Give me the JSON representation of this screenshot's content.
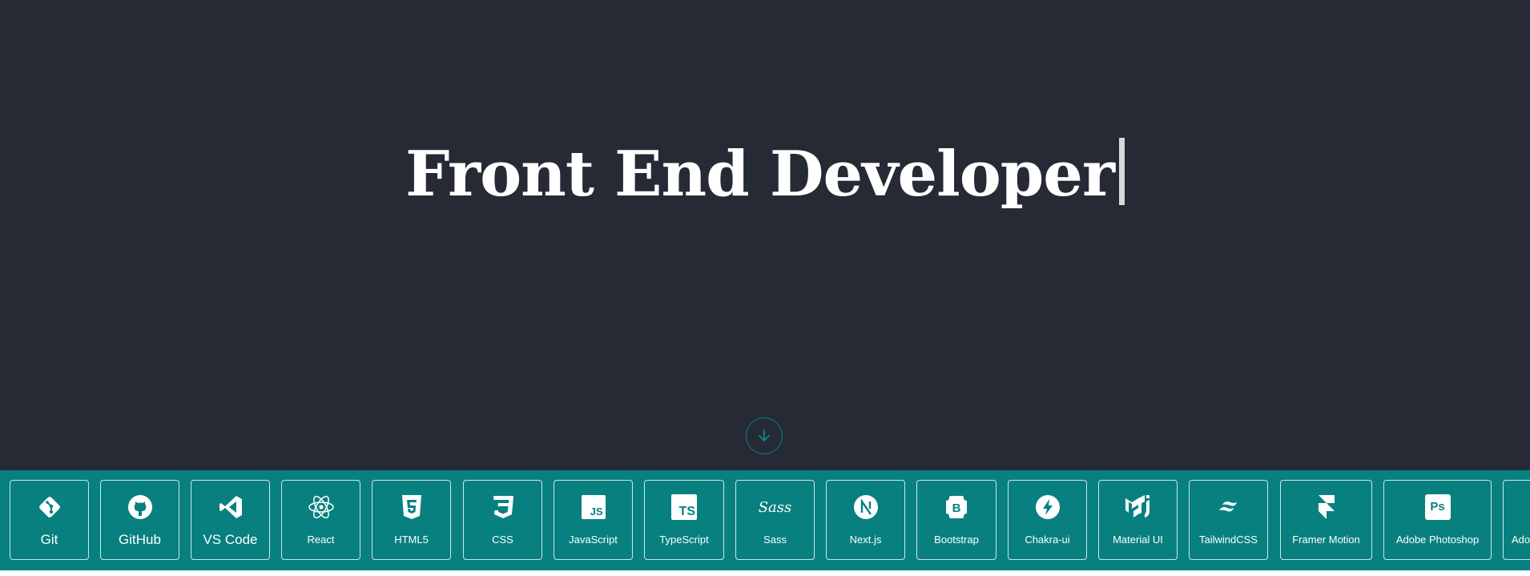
{
  "hero": {
    "headline": "Front End Developer"
  },
  "scroll_button": {
    "icon": "arrow-down-circle-icon"
  },
  "colors": {
    "hero_bg": "#252a34",
    "skills_bg": "#088080",
    "accent": "#0f7c7c"
  },
  "skills": [
    {
      "label": "Git",
      "icon": "git-icon"
    },
    {
      "label": "GitHub",
      "icon": "github-icon"
    },
    {
      "label": "VS Code",
      "icon": "vscode-icon"
    },
    {
      "label": "React",
      "icon": "react-icon"
    },
    {
      "label": "HTML5",
      "icon": "html5-icon"
    },
    {
      "label": "CSS",
      "icon": "css3-icon"
    },
    {
      "label": "JavaScript",
      "icon": "javascript-icon"
    },
    {
      "label": "TypeScript",
      "icon": "typescript-icon"
    },
    {
      "label": "Sass",
      "icon": "sass-icon"
    },
    {
      "label": "Next.js",
      "icon": "nextjs-icon"
    },
    {
      "label": "Bootstrap",
      "icon": "bootstrap-icon"
    },
    {
      "label": "Chakra-ui",
      "icon": "chakra-ui-icon"
    },
    {
      "label": "Material UI",
      "icon": "material-ui-icon"
    },
    {
      "label": "TailwindCSS",
      "icon": "tailwindcss-icon"
    },
    {
      "label": "Framer Motion",
      "icon": "framer-motion-icon"
    },
    {
      "label": "Adobe Photoshop",
      "icon": "photoshop-icon"
    },
    {
      "label": "Adobe",
      "icon": "adobe-icon"
    }
  ]
}
